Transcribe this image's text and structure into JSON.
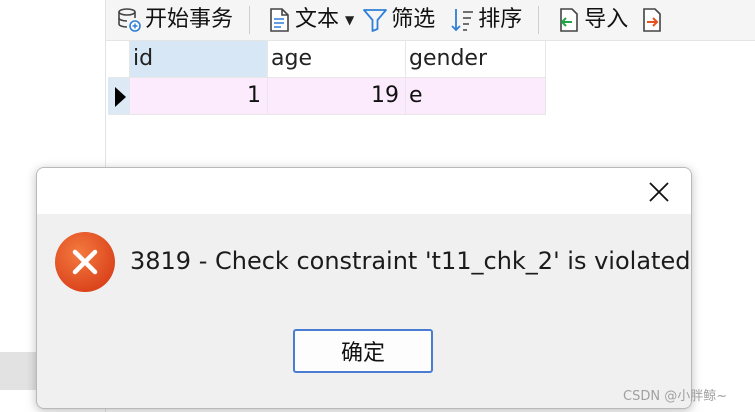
{
  "toolbar": {
    "items": [
      {
        "label": "开始事务",
        "icon": "database-transaction-icon"
      },
      {
        "label": "文本",
        "icon": "text-document-icon"
      },
      {
        "label": "筛选",
        "icon": "filter-icon"
      },
      {
        "label": "排序",
        "icon": "sort-icon"
      },
      {
        "label": "导入",
        "icon": "import-icon"
      }
    ]
  },
  "grid": {
    "columns": [
      "id",
      "age",
      "gender"
    ],
    "rows": [
      {
        "id": "1",
        "age": "19",
        "gender": "e"
      }
    ]
  },
  "dialog": {
    "message": "3819 - Check constraint 't11_chk_2' is violated.",
    "ok_label": "确定",
    "icon": "error-icon"
  },
  "watermark": "CSDN @小胖鲸~",
  "colors": {
    "error_red": "#e8521f",
    "selected_header": "#d7e7f6",
    "row_highlight": "#fcebfc",
    "button_border": "#4a7dd1"
  }
}
